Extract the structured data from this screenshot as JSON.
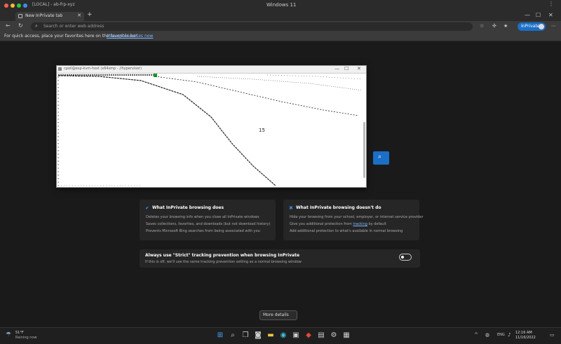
{
  "window": {
    "title": "[LOCAL] - ab-frp-xyz",
    "center_title": "Windows 11",
    "menu": "⋮"
  },
  "tab": {
    "label": "New InPrivate tab",
    "close": "✕",
    "new_tab": "+"
  },
  "window_controls": {
    "minimize": "—",
    "maximize": "☐",
    "close": "✕"
  },
  "address": {
    "placeholder": "Search or enter web address",
    "inprivate_label": "InPrivate"
  },
  "favorites_bar": {
    "text": "For quick access, place your favorites here on the favorites bar.",
    "link": "Manage favorites now"
  },
  "vnc_window": {
    "title": "cpoli@esp-kvm-host (x64smp - //hypervisor)",
    "controls": {
      "minimize": "—",
      "maximize": "☐",
      "close": "✕"
    },
    "label": "15"
  },
  "cards": [
    {
      "title": "What InPrivate browsing does",
      "icon": "check-icon",
      "lines": [
        "Deletes your browsing info when you close all InPrivate windows",
        "Saves collections, favorites, and downloads (but not download history)",
        "Prevents Microsoft Bing searches from being associated with you"
      ]
    },
    {
      "title": "What InPrivate browsing doesn't do",
      "icon": "cross-icon",
      "lines": [
        "Hide your browsing from your school, employer, or internet service provider",
        "Give you additional protection from",
        "Add additional protection to what's available in normal browsing"
      ],
      "link": "tracking",
      "line2_suffix": "by default"
    }
  ],
  "toggle": {
    "title": "Always use \"Strict\" tracking prevention when browsing InPrivate",
    "subtitle": "If this is off, we'll use the same tracking prevention setting as a normal browsing window",
    "on": true
  },
  "more_info": "More details",
  "taskbar": {
    "weather_temp": "51°F",
    "weather_desc": "Raining now",
    "lang": "ENG",
    "time": "12:16 AM",
    "date": "11/16/2022"
  },
  "colors": {
    "accent": "#1b6fc7",
    "background": "#1a1a1a",
    "card": "#262626"
  }
}
